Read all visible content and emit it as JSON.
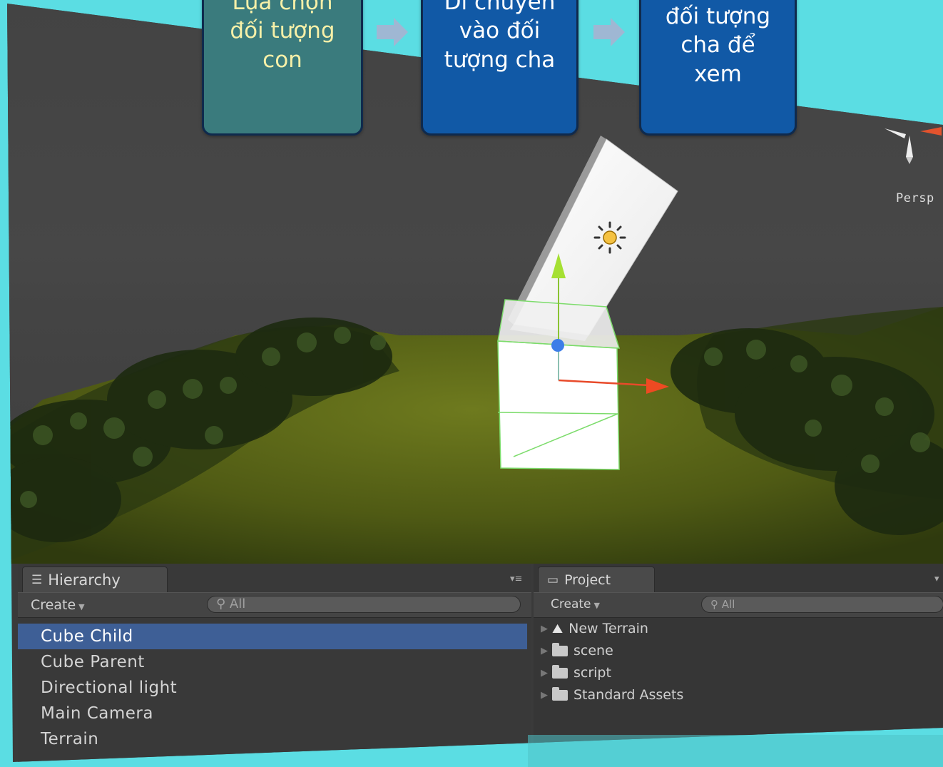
{
  "flow": {
    "step1": [
      "Lựa chọn",
      "đối tượng",
      "con"
    ],
    "step2": [
      "Di chuyển",
      "vào đối",
      "tượng cha"
    ],
    "step3": [
      "đối tượng",
      "cha để",
      "xem"
    ]
  },
  "scene": {
    "persp_label": "Persp"
  },
  "hierarchy": {
    "tab_label": "Hierarchy",
    "create_label": "Create",
    "search_placeholder": "All",
    "items": [
      "Cube Child",
      "Cube Parent",
      "Directional light",
      "Main Camera",
      "Terrain"
    ],
    "selected_index": 0
  },
  "project": {
    "tab_label": "Project",
    "create_label": "Create",
    "search_placeholder": "All",
    "items": [
      "New Terrain",
      "scene",
      "script",
      "Standard Assets"
    ]
  },
  "colors": {
    "background": "#5bdde3",
    "selection": "#3e5f96",
    "flow_box_teal": "#3a7b7d",
    "flow_box_blue": "#1159a6",
    "arrow": "#9fb7d3"
  }
}
